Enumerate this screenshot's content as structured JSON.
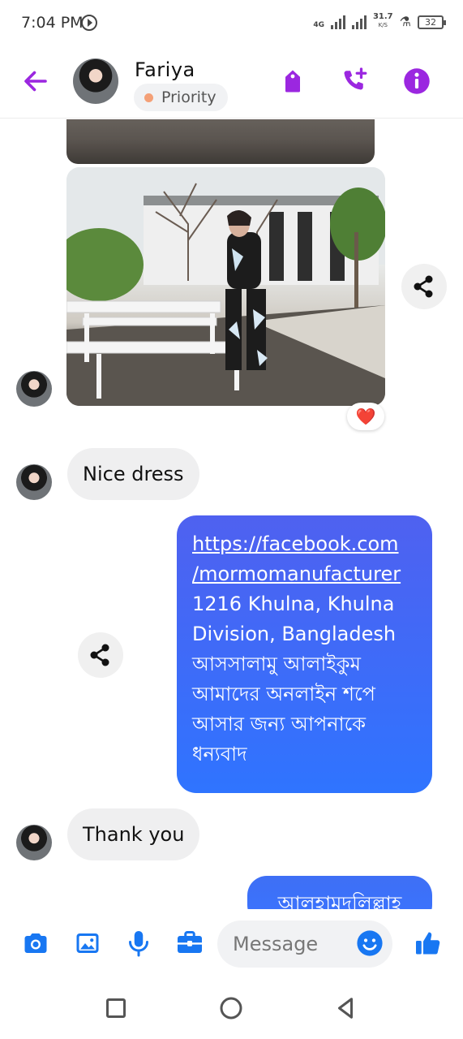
{
  "status_bar": {
    "time": "7:04 PM",
    "network_label": "4G",
    "speed_value": "31.7",
    "speed_unit": "K/S",
    "battery": "32"
  },
  "header": {
    "contact_name": "Fariya",
    "priority_label": "Priority",
    "accent_color": "#9b27e0",
    "icons": [
      "back-arrow-icon",
      "tag-icon",
      "add-call-icon",
      "info-icon"
    ]
  },
  "messages": {
    "received_1": "Nice dress",
    "sent_1": {
      "link_line_1": "https://facebook.com",
      "link_line_2": "/mormomanufacturer",
      "address_line_1": "1216 Khulna, Khulna",
      "address_line_2": "Division, Bangladesh",
      "bangla_line_1": "আসসালামু আলাইকুম",
      "bangla_line_2": "আমাদের অনলাইন শপে",
      "bangla_line_3": "আসার জন্য আপনাকে",
      "bangla_line_4": "ধন্যবাদ"
    },
    "received_2": "Thank you",
    "sent_2": "আলহামদুলিল্লাহ",
    "reaction": "❤️"
  },
  "composer": {
    "placeholder": "Message",
    "icons": [
      "camera-icon",
      "gallery-icon",
      "microphone-icon",
      "briefcase-icon",
      "emoji-icon",
      "thumbs-up-icon"
    ],
    "accent_color": "#1877f2"
  },
  "nav_bar": {
    "icons": [
      "recents-square-icon",
      "home-circle-icon",
      "back-triangle-icon"
    ]
  }
}
